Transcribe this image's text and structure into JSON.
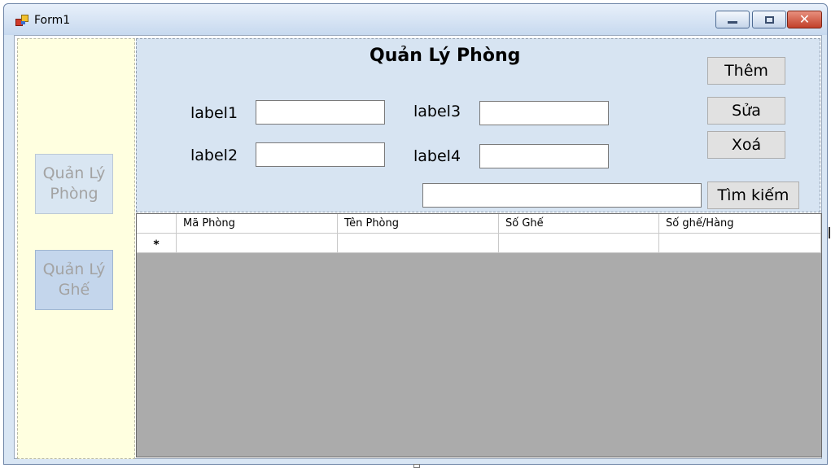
{
  "window": {
    "title": "Form1",
    "title_bar_color": "#c7d9ef",
    "caption_buttons": [
      "minimize-icon",
      "maximize-icon",
      "close-icon"
    ],
    "close_glyph": "✕"
  },
  "sidebar": {
    "background": "#ffffe0",
    "items": [
      {
        "label": "Quản Lý Phòng"
      },
      {
        "label": "Quản Lý Ghế"
      }
    ]
  },
  "panel": {
    "title": "Quản Lý Phòng",
    "background": "#d7e4f2",
    "labels": [
      "label1",
      "label2",
      "label3",
      "label4"
    ],
    "textboxes": [
      "",
      "",
      "",
      ""
    ],
    "search_value": "",
    "buttons": {
      "add": "Thêm",
      "edit": "Sửa",
      "delete": "Xoá",
      "search": "Tìm kiếm"
    }
  },
  "grid": {
    "background": "#ababab",
    "columns": [
      "Mã Phòng",
      "Tên Phòng",
      "Số Ghế",
      "Số ghế/Hàng"
    ],
    "new_row_marker": "*",
    "rows": []
  }
}
